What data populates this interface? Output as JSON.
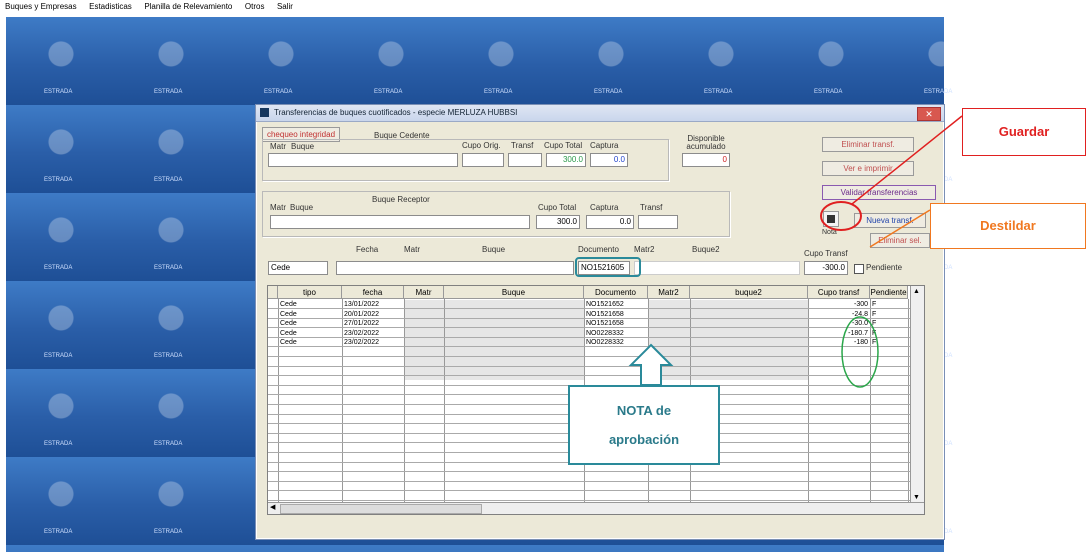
{
  "menu": [
    "Buques y Empresas",
    "Estadisticas",
    "Planilla de Relevamiento",
    "Otros",
    "Salir"
  ],
  "desktop": {
    "tile_label": "ESTRADA"
  },
  "window": {
    "title": "Transferencias de buques cuotificados - especie MERLUZA HUBBSI",
    "close_glyph": "✕"
  },
  "cedente": {
    "chequeo_button": "chequeo integridad",
    "group_title": "Buque Cedente",
    "headers": {
      "matr": "Matr",
      "buque": "Buque",
      "cupo_orig": "Cupo Orig.",
      "transf": "Transf",
      "cupo_total": "Cupo Total",
      "captura": "Captura",
      "disponible": "Disponible acumulado"
    },
    "values": {
      "cupo_total": "300.0",
      "captura": "0.0",
      "disponible": "0"
    }
  },
  "receptor": {
    "group_title": "Buque Receptor",
    "headers": {
      "matr": "Matr",
      "buque": "Buque",
      "cupo_total": "Cupo Total",
      "captura": "Captura",
      "transf": "Transf"
    },
    "values": {
      "cupo_total": "300.0",
      "captura": "0.0"
    }
  },
  "buttons": {
    "eliminar": "Eliminar transf.",
    "ver_imprimir": "Ver e imprimir",
    "ver_transferencias": "Validar transferencias",
    "nueva_transf": "Nueva transf.",
    "nota": "Nota",
    "eliminar_sel": "Eliminar sel."
  },
  "entry": {
    "headers": {
      "fecha": "Fecha",
      "matr": "Matr",
      "buque": "Buque",
      "documento": "Documento",
      "matr2": "Matr2",
      "buque2": "Buque2",
      "cupo_transf": "Cupo Transf"
    },
    "tipo": "Cede",
    "documento": "NO1521605",
    "cupo_transf": "-300.0",
    "pendiente_label": "Pendiente"
  },
  "grid": {
    "columns": [
      "tipo",
      "fecha",
      "Matr",
      "Buque",
      "Documento",
      "Matr2",
      "buque2",
      "Cupo transf",
      "Pendiente"
    ],
    "rows": [
      {
        "tipo": "Cede",
        "fecha": "13/01/2022",
        "doc": "NO1521652",
        "cupo": "-300",
        "pend": "F"
      },
      {
        "tipo": "Cede",
        "fecha": "20/01/2022",
        "doc": "NO1521658",
        "cupo": "-24.8",
        "pend": "F"
      },
      {
        "tipo": "Cede",
        "fecha": "27/01/2022",
        "doc": "NO1521658",
        "cupo": "-30.0",
        "pend": "F"
      },
      {
        "tipo": "Cede",
        "fecha": "23/02/2022",
        "doc": "NO0228332",
        "cupo": "-180.7",
        "pend": "F"
      },
      {
        "tipo": "Cede",
        "fecha": "23/02/2022",
        "doc": "NO0228332",
        "cupo": "-180",
        "pend": "F"
      }
    ]
  },
  "annotations": {
    "guardar": "Guardar",
    "destildar": "Destildar",
    "nota_line1": "NOTA de",
    "nota_line2": "aprobación",
    "colors": {
      "red": "#e02020",
      "orange": "#f07820",
      "teal": "#2a8a9a",
      "green": "#2aa64a"
    }
  }
}
